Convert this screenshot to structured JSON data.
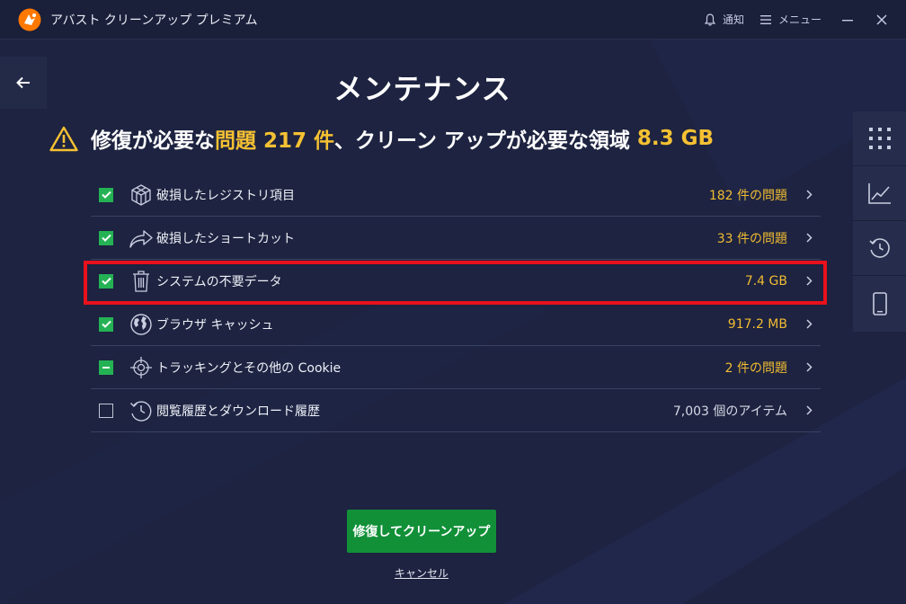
{
  "app": {
    "title": "アバスト クリーンアップ プレミアム"
  },
  "titlebar": {
    "notifications_label": "通知",
    "menu_label": "メニュー"
  },
  "page": {
    "title": "メンテナンス",
    "summary": {
      "part1": "修復が必要な",
      "problems_word": "問題",
      "problem_count": "217 件",
      "part2": "、クリーン アップが必要な領域",
      "space": "8.3 GB"
    }
  },
  "items": [
    {
      "label": "破損したレジストリ項目",
      "value": "182 件の問題",
      "state": "checked",
      "icon": "registry-cube-icon"
    },
    {
      "label": "破損したショートカット",
      "value": "33 件の問題",
      "state": "checked",
      "icon": "shortcut-arrow-icon"
    },
    {
      "label": "システムの不要データ",
      "value": "7.4 GB",
      "state": "checked",
      "icon": "trash-icon"
    },
    {
      "label": "ブラウザ キャッシュ",
      "value": "917.2 MB",
      "state": "checked",
      "icon": "globe-icon"
    },
    {
      "label": "トラッキングとその他の Cookie",
      "value": "2 件の問題",
      "state": "partial",
      "icon": "crosshair-icon"
    },
    {
      "label": "閲覧履歴とダウンロード履歴",
      "value": "7,003 個のアイテム",
      "state": "unchecked",
      "icon": "history-clock-icon"
    }
  ],
  "actions": {
    "fix_label": "修復してクリーンアップ",
    "cancel_label": "キャンセル"
  },
  "rail": [
    "grid-icon",
    "chart-icon",
    "history-icon",
    "phone-icon"
  ],
  "colors": {
    "background": "#1d2340",
    "accent_yellow": "#f5c133",
    "check_green": "#25b255",
    "button_green": "#119038",
    "highlight_red": "#e8111c"
  }
}
